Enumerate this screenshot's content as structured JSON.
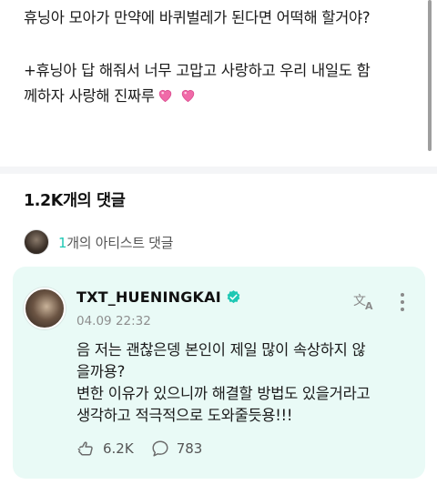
{
  "post": {
    "lines": [
      "휴닝아 모아가 만약에 바퀴벌레가 된다면 어떡해 할거야?",
      "+휴닝아 답 해줘서 너무 고맙고 사랑하고 우리 내일도 함",
      "께하자 사랑해 진짜루"
    ],
    "emoji": [
      "sparkling-heart",
      "sparkling-heart"
    ]
  },
  "comments": {
    "title": "1.2K개의 댓글",
    "artist_count": "1",
    "artist_label": "개의 아티스트 댓글"
  },
  "comment": {
    "author": "TXT_HUENINGKAI",
    "date": "04.09 22:32",
    "lines": [
      "음 저는 괜찮은뎅 본인이 제일 많이 속상하지 않",
      "을까용?",
      "변한 이유가 있으니까 해결할 방법도 있을거라고",
      "생각하고 적극적으로 도와줄듯용!!!"
    ],
    "likes": "6.2K",
    "replies": "783"
  },
  "colors": {
    "accent": "#1ec8b4",
    "card_bg": "#e9faf6",
    "heart": "#f06aa8"
  }
}
